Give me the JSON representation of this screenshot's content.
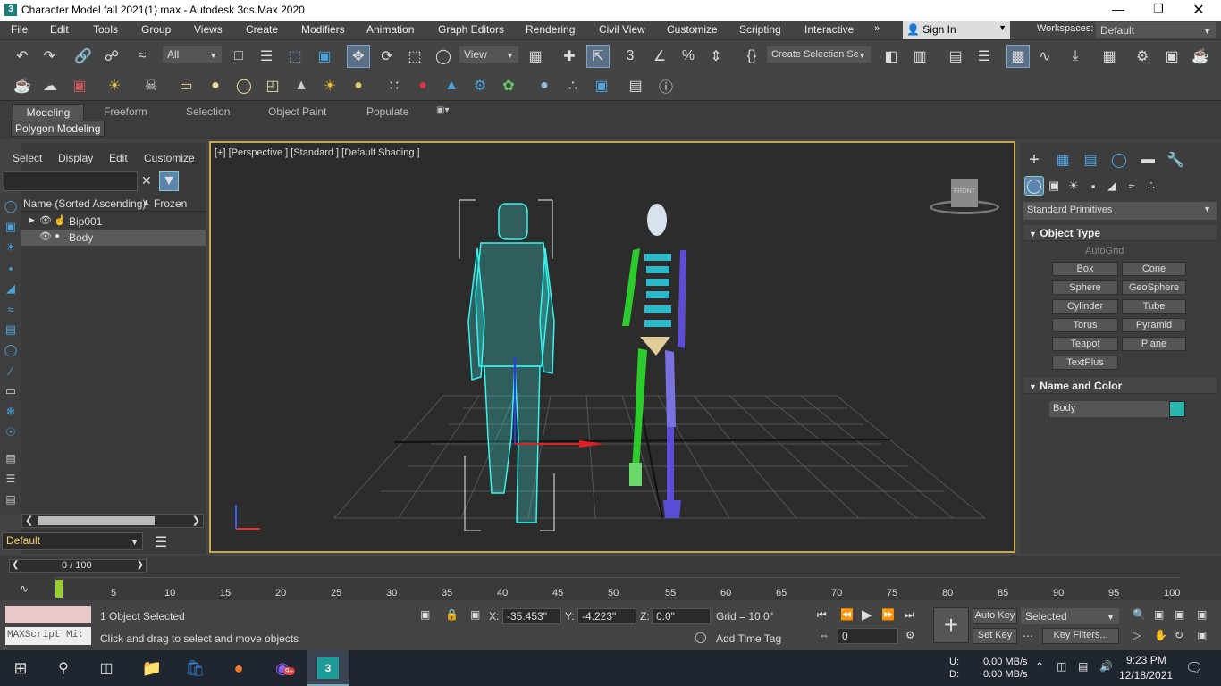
{
  "title": "Character Model fall 2021(1).max - Autodesk 3ds Max 2020",
  "menu": [
    "File",
    "Edit",
    "Tools",
    "Group",
    "Views",
    "Create",
    "Modifiers",
    "Animation",
    "Graph Editors",
    "Rendering",
    "Civil View",
    "Customize",
    "Scripting",
    "Interactive"
  ],
  "signin": "Sign In",
  "workspaces_label": "Workspaces:",
  "workspace_value": "Default",
  "toolbar": {
    "filter_value": "All",
    "refcoord_value": "View",
    "selection_set_placeholder": "Create Selection Se"
  },
  "ribbon_tabs": [
    "Modeling",
    "Freeform",
    "Selection",
    "Object Paint",
    "Populate"
  ],
  "ribbon_sub": "Polygon Modeling",
  "scene_explorer": {
    "menu": [
      "Select",
      "Display",
      "Edit",
      "Customize"
    ],
    "col_name": "Name (Sorted Ascending)",
    "col_frozen": "Frozen",
    "rows": [
      "Bip001",
      "Body"
    ],
    "layer": "Default"
  },
  "viewport_label": "[+] [Perspective ] [Standard ] [Default Shading ]",
  "viewcube_label": "FRONT",
  "command_panel": {
    "dropdown": "Standard Primitives",
    "object_type_title": "Object Type",
    "autogrid": "AutoGrid",
    "buttons": [
      "Box",
      "Cone",
      "Sphere",
      "GeoSphere",
      "Cylinder",
      "Tube",
      "Torus",
      "Pyramid",
      "Teapot",
      "Plane",
      "TextPlus"
    ],
    "name_color_title": "Name and Color",
    "object_name": "Body",
    "object_color": "#29b5b0"
  },
  "timeline": {
    "frame_display": "0 / 100",
    "ticks": [
      "5",
      "10",
      "15",
      "20",
      "25",
      "30",
      "35",
      "40",
      "45",
      "50",
      "55",
      "60",
      "65",
      "70",
      "75",
      "80",
      "85",
      "90",
      "95",
      "100"
    ]
  },
  "status": {
    "maxscript": "MAXScript Mi:",
    "selected": "1 Object Selected",
    "prompt": "Click and drag to select and move objects",
    "x_label": "X:",
    "x_value": "-35.453\"",
    "y_label": "Y:",
    "y_value": "-4.223\"",
    "z_label": "Z:",
    "z_value": "0.0\"",
    "grid": "Grid = 10.0\"",
    "add_time_tag": "Add Time Tag",
    "auto_key": "Auto Key",
    "set_key": "Set Key",
    "selected_dropdown": "Selected",
    "key_filters": "Key Filters...",
    "frame_spinner": "0"
  },
  "taskbar": {
    "net_up_label": "U:",
    "net_up": "0.00 MB/s",
    "net_down_label": "D:",
    "net_down": "0.00 MB/s",
    "time": "9:23 PM",
    "date": "12/18/2021",
    "badge": "9+"
  }
}
